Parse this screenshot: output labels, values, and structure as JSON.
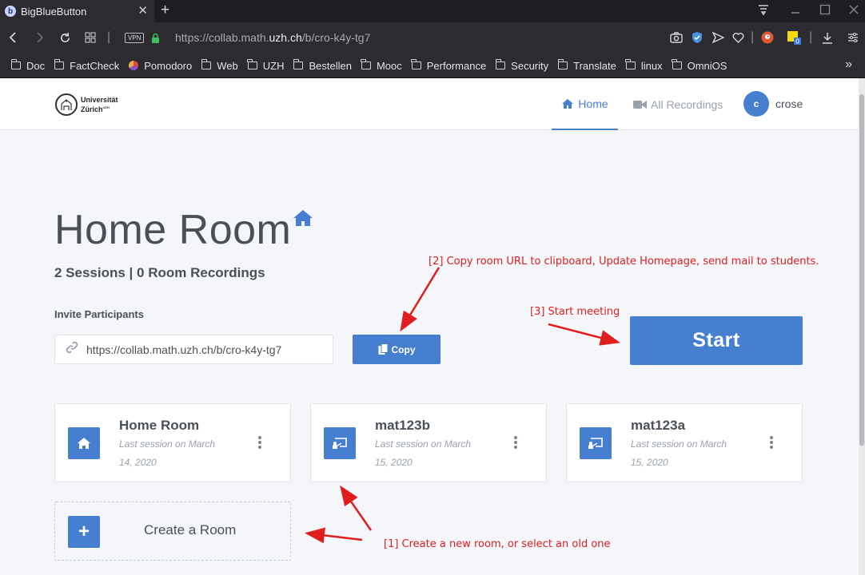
{
  "browser": {
    "tab_title": "BigBlueButton",
    "tab_favicon": "b",
    "url_prefix": "https://collab.math.",
    "url_domain": "uzh.ch",
    "url_path": "/b/cro-k4y-tg7",
    "vpn_label": "VPN",
    "extension_badge": "0"
  },
  "bookmarks": [
    "Doc",
    "FactCheck",
    "Pomodoro",
    "Web",
    "UZH",
    "Bestellen",
    "Mooc",
    "Performance",
    "Security",
    "Translate",
    "linux",
    "OmniOS"
  ],
  "header": {
    "logo_line1": "Universität",
    "logo_line2": "Zürich",
    "logo_sup": "UZH",
    "nav_home": "Home",
    "nav_recordings": "All Recordings",
    "avatar_initial": "c",
    "username": "crose"
  },
  "main": {
    "title": "Home Room",
    "subtitle": "2 Sessions | 0 Room Recordings",
    "invite_label": "Invite Participants",
    "invite_url": "https://collab.math.uzh.ch/b/cro-k4y-tg7",
    "copy_label": "Copy",
    "start_label": "Start"
  },
  "rooms": [
    {
      "name": "Home Room",
      "meta": "Last session on March 14, 2020",
      "icon": "home-icon"
    },
    {
      "name": "mat123b",
      "meta": "Last session on March 15, 2020",
      "icon": "presentation-icon"
    },
    {
      "name": "mat123a",
      "meta": "Last session on March 15, 2020",
      "icon": "presentation-icon"
    }
  ],
  "create_room_label": "Create a Room",
  "annotations": {
    "step1": "[1] Create a new room, or select an old one",
    "step2": "[2] Copy room URL to clipboard, Update Homepage, send mail to students.",
    "step3": "[3] Start meeting"
  },
  "colors": {
    "accent": "#467fcf",
    "annotation": "#e01e1e"
  }
}
